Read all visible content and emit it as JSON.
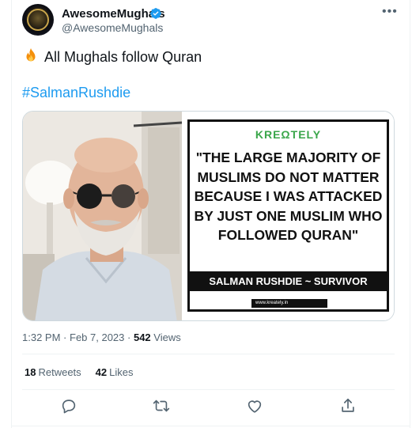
{
  "author": {
    "display_name": "AwesomeMughals",
    "handle": "@AwesomeMughals",
    "verified": true,
    "avatar_icon": "mughal-emblem-avatar"
  },
  "tweet": {
    "emoji": "fire",
    "text": "All Mughals follow Quran",
    "hashtag": "#SalmanRushdie"
  },
  "media": {
    "brand": "KREΩTELY",
    "quote": "\"THE LARGE MAJORITY OF MUSLIMS DO NOT MATTER BECAUSE I WAS ATTACKED BY JUST ONE MUSLIM WHO FOLLOWED QURAN\"",
    "author_line": "SALMAN RUSHDIE ~ SURVIVOR",
    "url": "www.kreately.in"
  },
  "meta": {
    "time": "1:32 PM",
    "date": "Feb 7, 2023",
    "views_count": "542",
    "views_label": "Views"
  },
  "stats": {
    "retweets_count": "18",
    "retweets_label": "Retweets",
    "likes_count": "42",
    "likes_label": "Likes"
  },
  "actions": [
    "reply-icon",
    "retweet-icon",
    "like-icon",
    "share-icon"
  ],
  "colors": {
    "link": "#1d9bf0",
    "secondary_text": "#536471",
    "brand_green": "#3aa64a"
  }
}
